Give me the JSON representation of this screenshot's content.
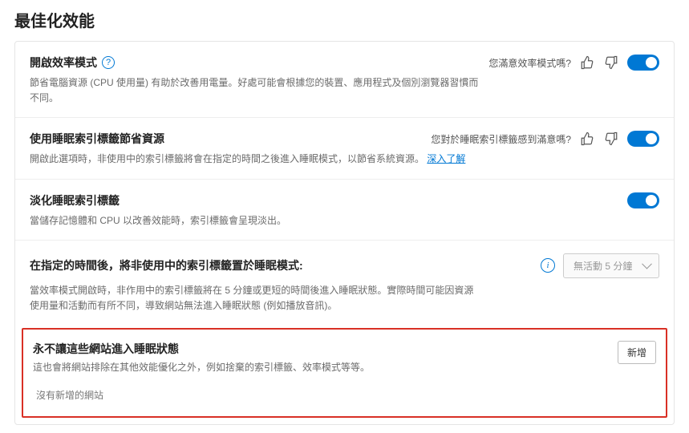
{
  "page_title": "最佳化效能",
  "efficiency": {
    "title": "開啟效率模式",
    "desc": "節省電腦資源 (CPU 使用量) 有助於改善用電量。好處可能會根據您的裝置、應用程式及個別瀏覽器習慣而不同。",
    "feedback_prompt": "您滿意效率模式嗎?"
  },
  "sleeping_tabs": {
    "title": "使用睡眠索引標籤節省資源",
    "desc_pre": "開啟此選項時，非使用中的索引標籤將會在指定的時間之後進入睡眠模式，以節省系統資源。",
    "link": "深入了解",
    "feedback_prompt": "您對於睡眠索引標籤感到滿意嗎?"
  },
  "fade": {
    "title": "淡化睡眠索引標籤",
    "desc": "當儲存記憶體和 CPU 以改善效能時，索引標籤會呈現淡出。"
  },
  "timeout": {
    "title": "在指定的時間後，將非使用中的索引標籤置於睡眠模式:",
    "desc": "當效率模式開啟時，非作用中的索引標籤將在 5 分鐘或更短的時間後進入睡眠狀態。實際時間可能因資源使用量和活動而有所不同，導致網站無法進入睡眠狀態 (例如播放音訊)。",
    "dropdown_value": "無活動 5 分鐘"
  },
  "never_sleep": {
    "title": "永不讓這些網站進入睡眠狀態",
    "desc": "這也會將網站排除在其他效能優化之外，例如捨棄的索引標籤、效率模式等等。",
    "add_label": "新增",
    "empty": "沒有新增的網站"
  }
}
